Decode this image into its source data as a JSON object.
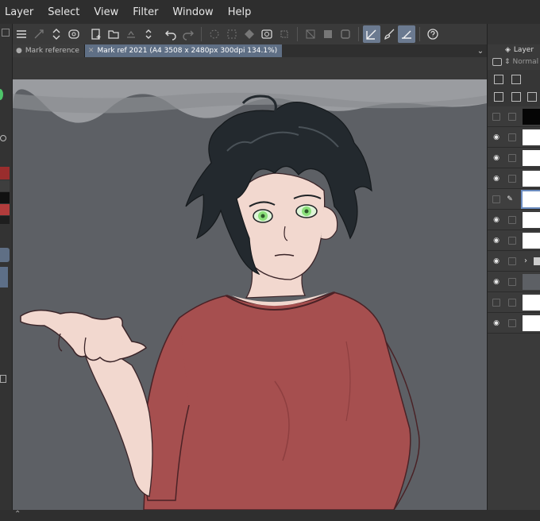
{
  "menu": [
    "Layer",
    "Select",
    "View",
    "Filter",
    "Window",
    "Help"
  ],
  "tabs": [
    {
      "label": "Mark reference"
    },
    {
      "label": "Mark ref 2021 (A4 3508 x 2480px 300dpi 134.1%)"
    }
  ],
  "layer_panel": {
    "title": "Layer",
    "blend_mode": "Normal",
    "rows": 11
  },
  "colors": {
    "accent": "#5f6f85",
    "canvas_bg": "#5d6065",
    "shirt": "#a64f4f",
    "hair": "#23292e",
    "eyes": "#8be07a"
  },
  "icons": [
    "menu-icon",
    "transform-icon",
    "stepper-icon",
    "snap-icon",
    "new-icon",
    "open-icon",
    "save-icon",
    "updown-icon",
    "undo-icon",
    "redo-icon",
    "select-icon",
    "clear-icon",
    "fill-icon",
    "camera-icon",
    "crop-icon",
    "hide-icon",
    "tone-icon",
    "border-icon",
    "pen-icon",
    "brush-icon",
    "ruler-icon",
    "help-icon"
  ]
}
